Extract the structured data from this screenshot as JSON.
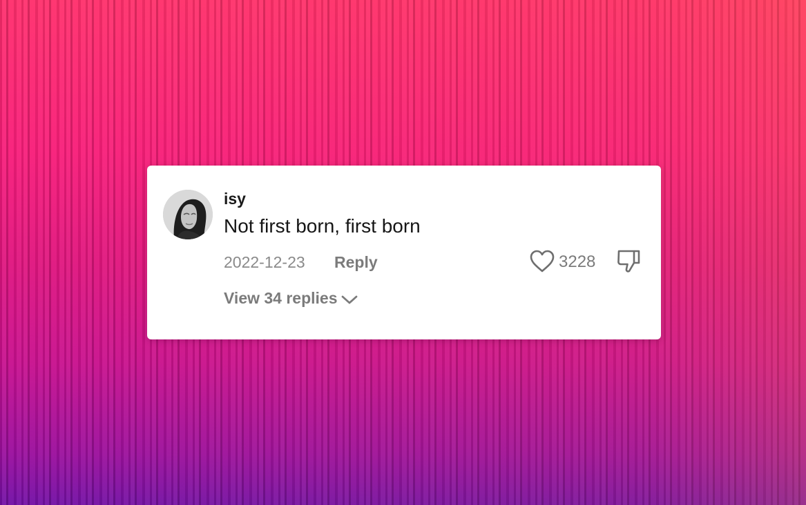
{
  "comment": {
    "username": "isy",
    "text": "Not first born, first born",
    "date": "2022-12-23",
    "reply_label": "Reply",
    "like_count": "3228",
    "view_replies_label": "View 34 replies",
    "icons": {
      "avatar": "avatar",
      "like": "heart-icon",
      "dislike": "thumbs-down-icon",
      "expand": "chevron-down-icon"
    }
  },
  "colors": {
    "background_top": "#ff2f6c",
    "background_bottom": "#7210a6",
    "card": "#ffffff",
    "muted_text": "#7b7b7b"
  }
}
